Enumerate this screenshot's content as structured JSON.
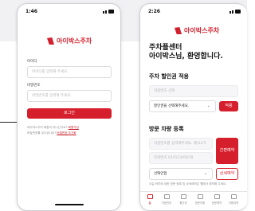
{
  "login_screen": {
    "status_time": "1:46",
    "brand": "아이박스주차",
    "id_label": "아이디",
    "id_placeholder": "아이디를 입력해 주세요.",
    "pw_label": "비밀번호",
    "pw_placeholder": "비밀번호를 입력해 주세요.",
    "login_button": "로그인",
    "notice_1_text": "아이박스주차 회원이 아니신가요?",
    "notice_1_link": "회원가입",
    "notice_2_text": "비밀번호를 잊으셨나요?",
    "notice_2_link": "비밀번호 초기화"
  },
  "main_screen": {
    "status_time": "2:26",
    "brand": "아이박스주차",
    "greeting_line1": "주차플센터",
    "greeting_line2": "아이박스님, 환영합니다.",
    "discount_title": "주차 할인권 적용",
    "car_number_placeholder": "차량번호 선택",
    "discount_select": "할인권을 선택해주세요.",
    "apply_button": "적용",
    "visitor_title": "방문 차량 등록",
    "visitor_car_placeholder": "차량번호를 입력해주세요. 예)12가",
    "phone_placeholder": "전화번호 01012345678",
    "quick_register_button": "간편예약",
    "option_select": "선택안함",
    "detail_register_button": "상세예약",
    "footnote": "오늘 하루에 대한 방문 등록 및 상세예약은 웹에서 예약해 주세요.",
    "tabs": [
      {
        "label": "홈",
        "active": true
      },
      {
        "label": "차량관리",
        "active": false
      },
      {
        "label": "할인권",
        "active": false
      },
      {
        "label": "방문차량",
        "active": false
      },
      {
        "label": "방문예약",
        "active": false
      },
      {
        "label": "이용내역",
        "active": false
      }
    ]
  },
  "colors": {
    "brand_red": "#d61f2c"
  }
}
